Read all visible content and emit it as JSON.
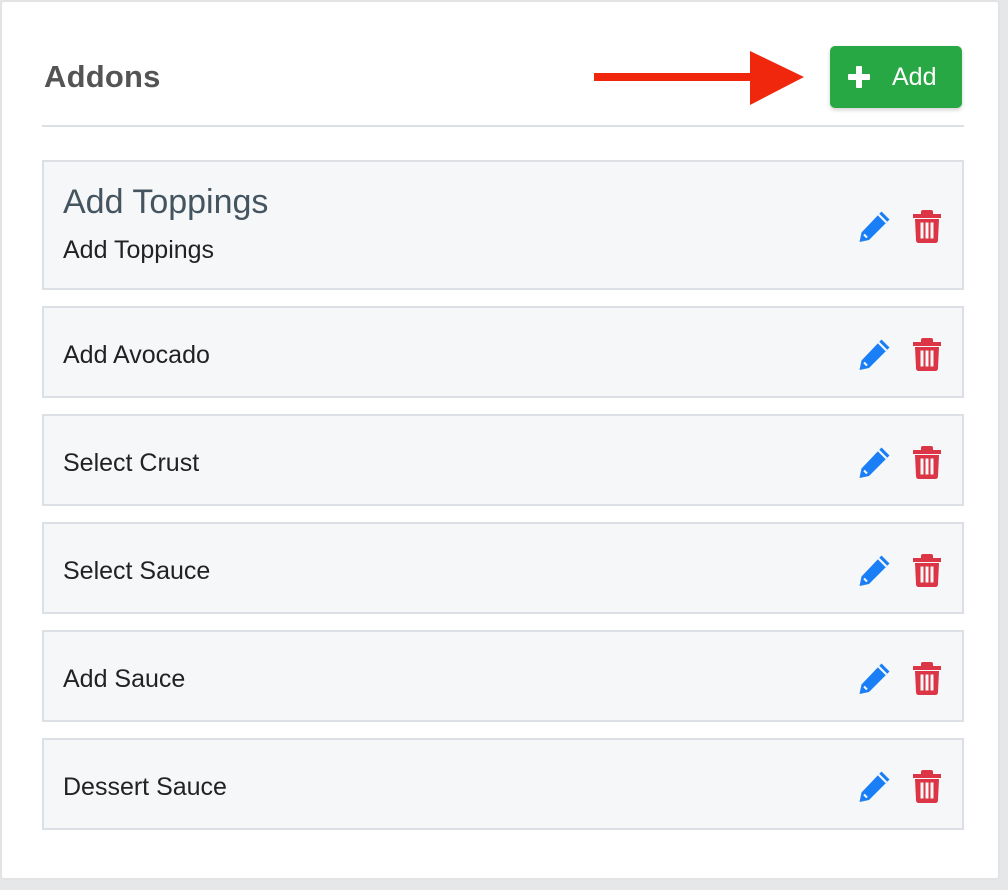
{
  "page": {
    "title": "Addons"
  },
  "toolbar": {
    "add_label": "Add",
    "add_icon": "plus-icon",
    "annotation_icon": "red-arrow-icon"
  },
  "addons": [
    {
      "title": "Add Toppings",
      "subtitle": "Add Toppings"
    },
    {
      "label": "Add Avocado"
    },
    {
      "label": "Select Crust"
    },
    {
      "label": "Select Sauce"
    },
    {
      "label": "Add Sauce"
    },
    {
      "label": "Dessert Sauce"
    }
  ],
  "row_actions": {
    "edit_icon": "pencil-icon",
    "delete_icon": "trash-icon"
  },
  "colors": {
    "add_button": "#28a745",
    "edit_icon": "#1a7ef7",
    "delete_icon": "#dc3545",
    "arrow": "#f0260d"
  }
}
